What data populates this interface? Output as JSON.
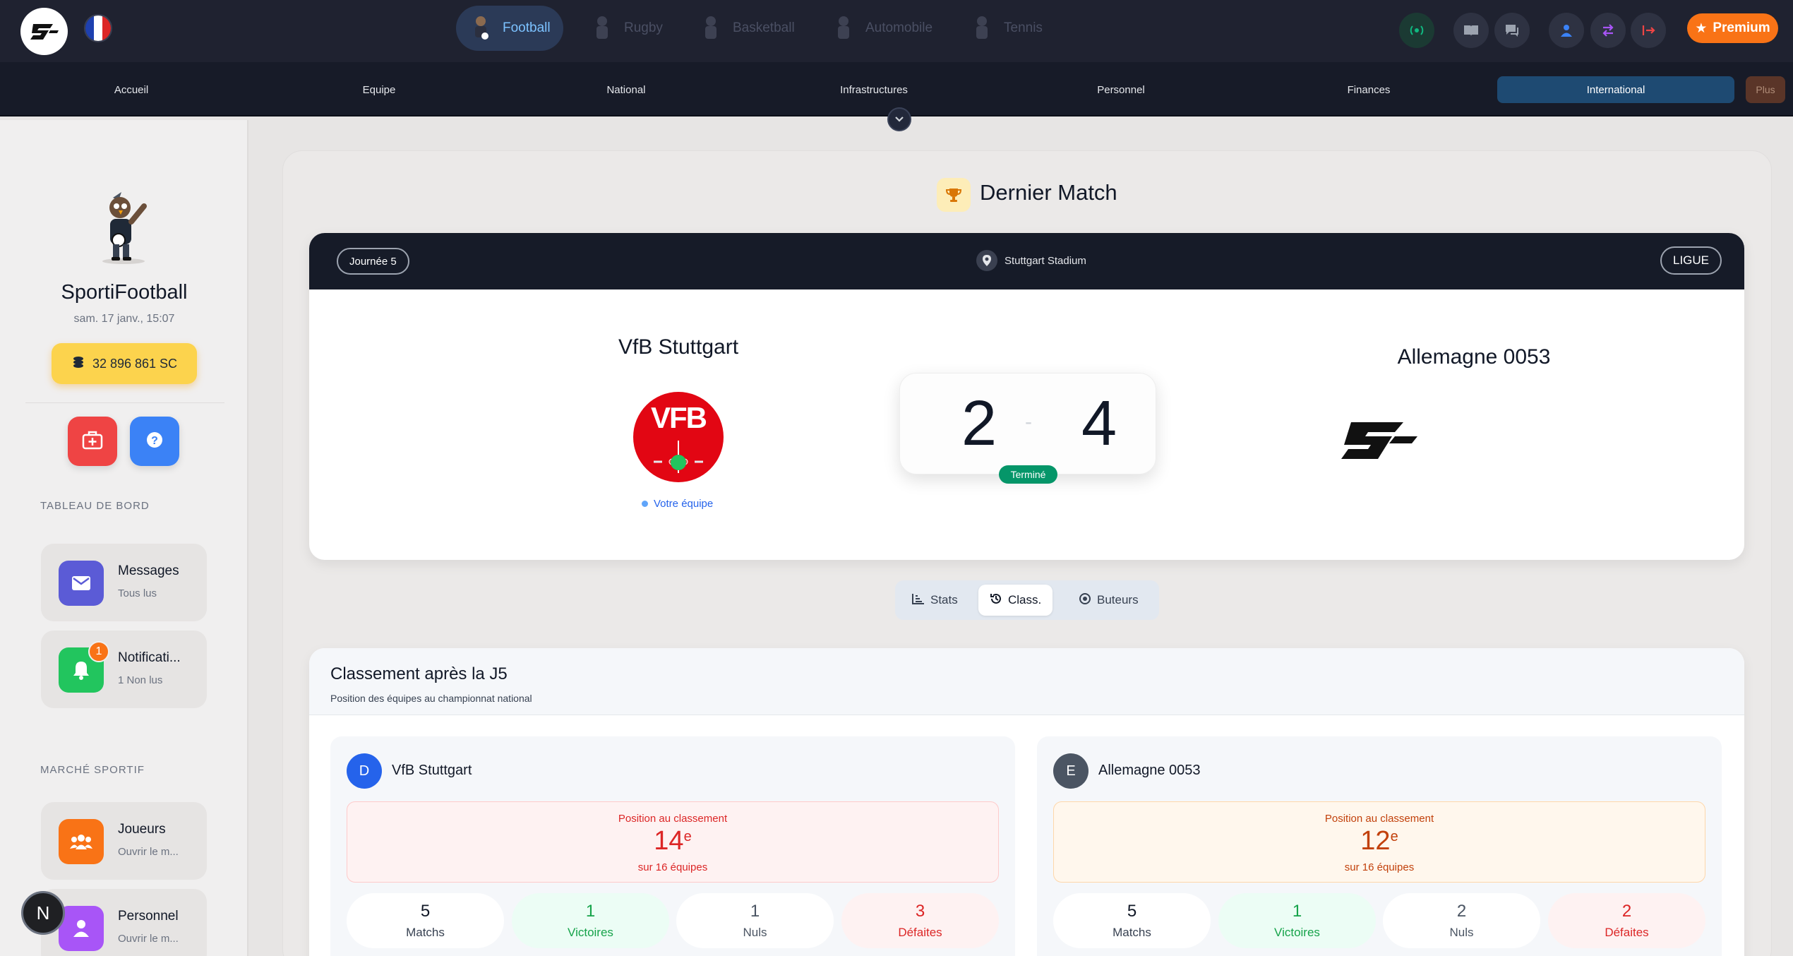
{
  "topbar": {
    "logo_text": "SF",
    "flag": "France",
    "sports": [
      {
        "label": "Football",
        "active": true
      },
      {
        "label": "Rugby",
        "active": false
      },
      {
        "label": "Basketball",
        "active": false
      },
      {
        "label": "Automobile",
        "active": false
      },
      {
        "label": "Tennis",
        "active": false
      }
    ],
    "icons": [
      "live-signal-icon",
      "book-icon",
      "chat-icon",
      "user-icon",
      "swap-icon",
      "logout-icon"
    ],
    "premium_label": "Premium"
  },
  "subnav": {
    "items": [
      {
        "label": "Accueil",
        "active": false
      },
      {
        "label": "Equipe",
        "active": false
      },
      {
        "label": "National",
        "active": false
      },
      {
        "label": "Infrastructures",
        "active": false
      },
      {
        "label": "Personnel",
        "active": false
      },
      {
        "label": "Finances",
        "active": false
      },
      {
        "label": "International",
        "active": true
      }
    ],
    "more_label": "Plus"
  },
  "sidebar": {
    "brand": "SportiFootball",
    "datetime": "sam. 17 janv., 15:07",
    "coins": "32 896 861 SC",
    "section_dashboard": "TABLEAU DE BORD",
    "messages": {
      "title": "Messages",
      "subtitle": "Tous lus"
    },
    "notifications": {
      "title": "Notificati...",
      "subtitle": "1 Non lus",
      "badge": "1"
    },
    "section_market": "MARCHÉ SPORTIF",
    "players": {
      "title": "Joueurs",
      "subtitle": "Ouvrir le m..."
    },
    "staff": {
      "title": "Personnel",
      "subtitle": "Ouvrir le m..."
    },
    "user_initial": "N"
  },
  "last_match": {
    "title": "Dernier Match",
    "round": "Journée 5",
    "stadium": "Stuttgart Stadium",
    "competition": "LIGUE",
    "home": {
      "name": "VfB Stuttgart",
      "logo_text": "VFB",
      "tag": "Votre équipe"
    },
    "away": {
      "name": "Allemagne 0053",
      "logo_text": "SF"
    },
    "score_home": "2",
    "score_away": "4",
    "score_sep": "-",
    "status": "Terminé"
  },
  "tabs": [
    {
      "label": "Stats",
      "icon": "bar-chart-icon",
      "active": false
    },
    {
      "label": "Class.",
      "icon": "history-icon",
      "active": true
    },
    {
      "label": "Buteurs",
      "icon": "target-icon",
      "active": false
    }
  ],
  "standings": {
    "title": "Classement après la J5",
    "subtitle": "Position des équipes au championnat national",
    "teams": [
      {
        "initial": "D",
        "name": "VfB Stuttgart",
        "position_label": "Position au classement",
        "position": "14",
        "position_suffix": "e",
        "position_total": "sur 16 équipes",
        "matches": "5",
        "matches_label": "Matchs",
        "wins": "1",
        "wins_label": "Victoires",
        "draws": "1",
        "draws_label": "Nuls",
        "losses": "3",
        "losses_label": "Défaites",
        "accent": "#dc2626"
      },
      {
        "initial": "E",
        "name": "Allemagne 0053",
        "position_label": "Position au classement",
        "position": "12",
        "position_suffix": "e",
        "position_total": "sur 16 équipes",
        "matches": "5",
        "matches_label": "Matchs",
        "wins": "1",
        "wins_label": "Victoires",
        "draws": "2",
        "draws_label": "Nuls",
        "losses": "2",
        "losses_label": "Défaites",
        "accent": "#c2410c"
      }
    ]
  }
}
